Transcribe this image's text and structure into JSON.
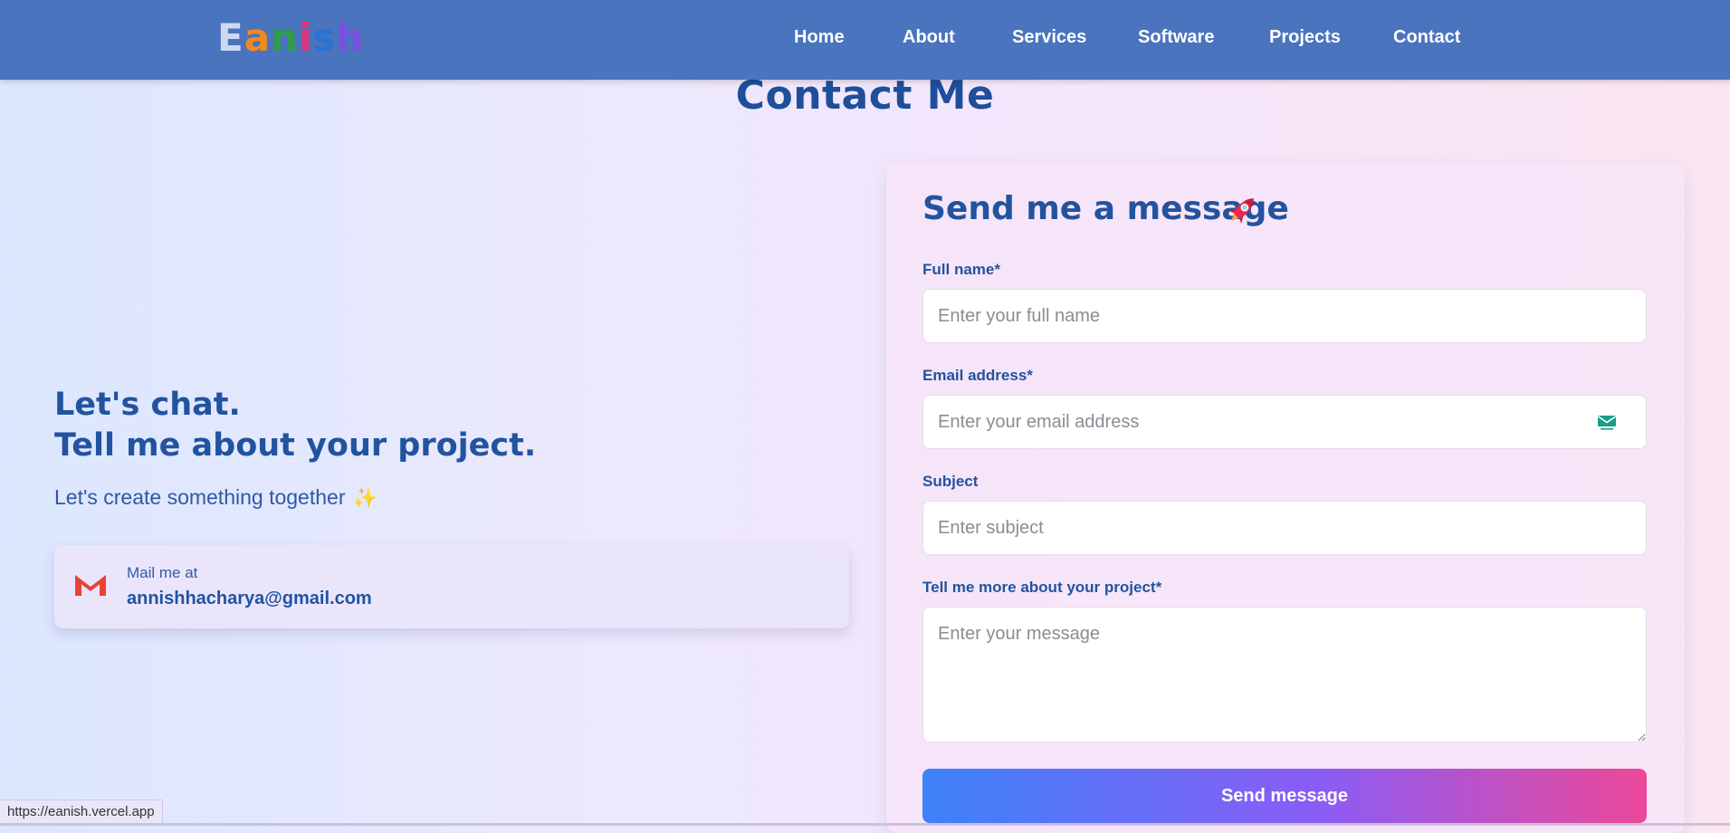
{
  "nav": {
    "logo_letters": [
      {
        "char": "E",
        "color": "#cfd8f0"
      },
      {
        "char": "a",
        "color": "#f08a1c"
      },
      {
        "char": "n",
        "color": "#2e9e4a"
      },
      {
        "char": "i",
        "color": "#e0357a"
      },
      {
        "char": "s",
        "color": "#2a73d6"
      },
      {
        "char": "h",
        "color": "#7b4fe0"
      }
    ],
    "items": [
      {
        "label": "Home"
      },
      {
        "label": "About"
      },
      {
        "label": "Services"
      },
      {
        "label": "Software"
      },
      {
        "label": "Projects"
      },
      {
        "label": "Contact"
      }
    ]
  },
  "page": {
    "title": "Contact Me"
  },
  "intro": {
    "heading_line1": "Let's chat.",
    "heading_line2": "Tell me about your project.",
    "subtitle": "Let's create something together",
    "subtitle_icon": "sparkles-icon",
    "mail_card": {
      "icon": "gmail-icon",
      "label": "Mail me at",
      "address": "annishhacharya@gmail.com"
    }
  },
  "form": {
    "title": "Send me a message",
    "title_icon": "rocket-icon",
    "full_name": {
      "label": "Full name*",
      "placeholder": "Enter your full name",
      "value": ""
    },
    "email": {
      "label": "Email address*",
      "placeholder": "Enter your email address",
      "value": "",
      "icon": "email-icon"
    },
    "subject": {
      "label": "Subject",
      "placeholder": "Enter subject",
      "value": ""
    },
    "message": {
      "label": "Tell me more about your project*",
      "placeholder": "Enter your message",
      "value": ""
    },
    "submit_label": "Send message"
  },
  "status_bar": {
    "url": "https://eanish.vercel.app"
  },
  "colors": {
    "nav_bg": "#4a74bd",
    "heading": "#22539f",
    "button_gradient": [
      "#3c82f6",
      "#8b5cf6",
      "#ec4899"
    ]
  }
}
